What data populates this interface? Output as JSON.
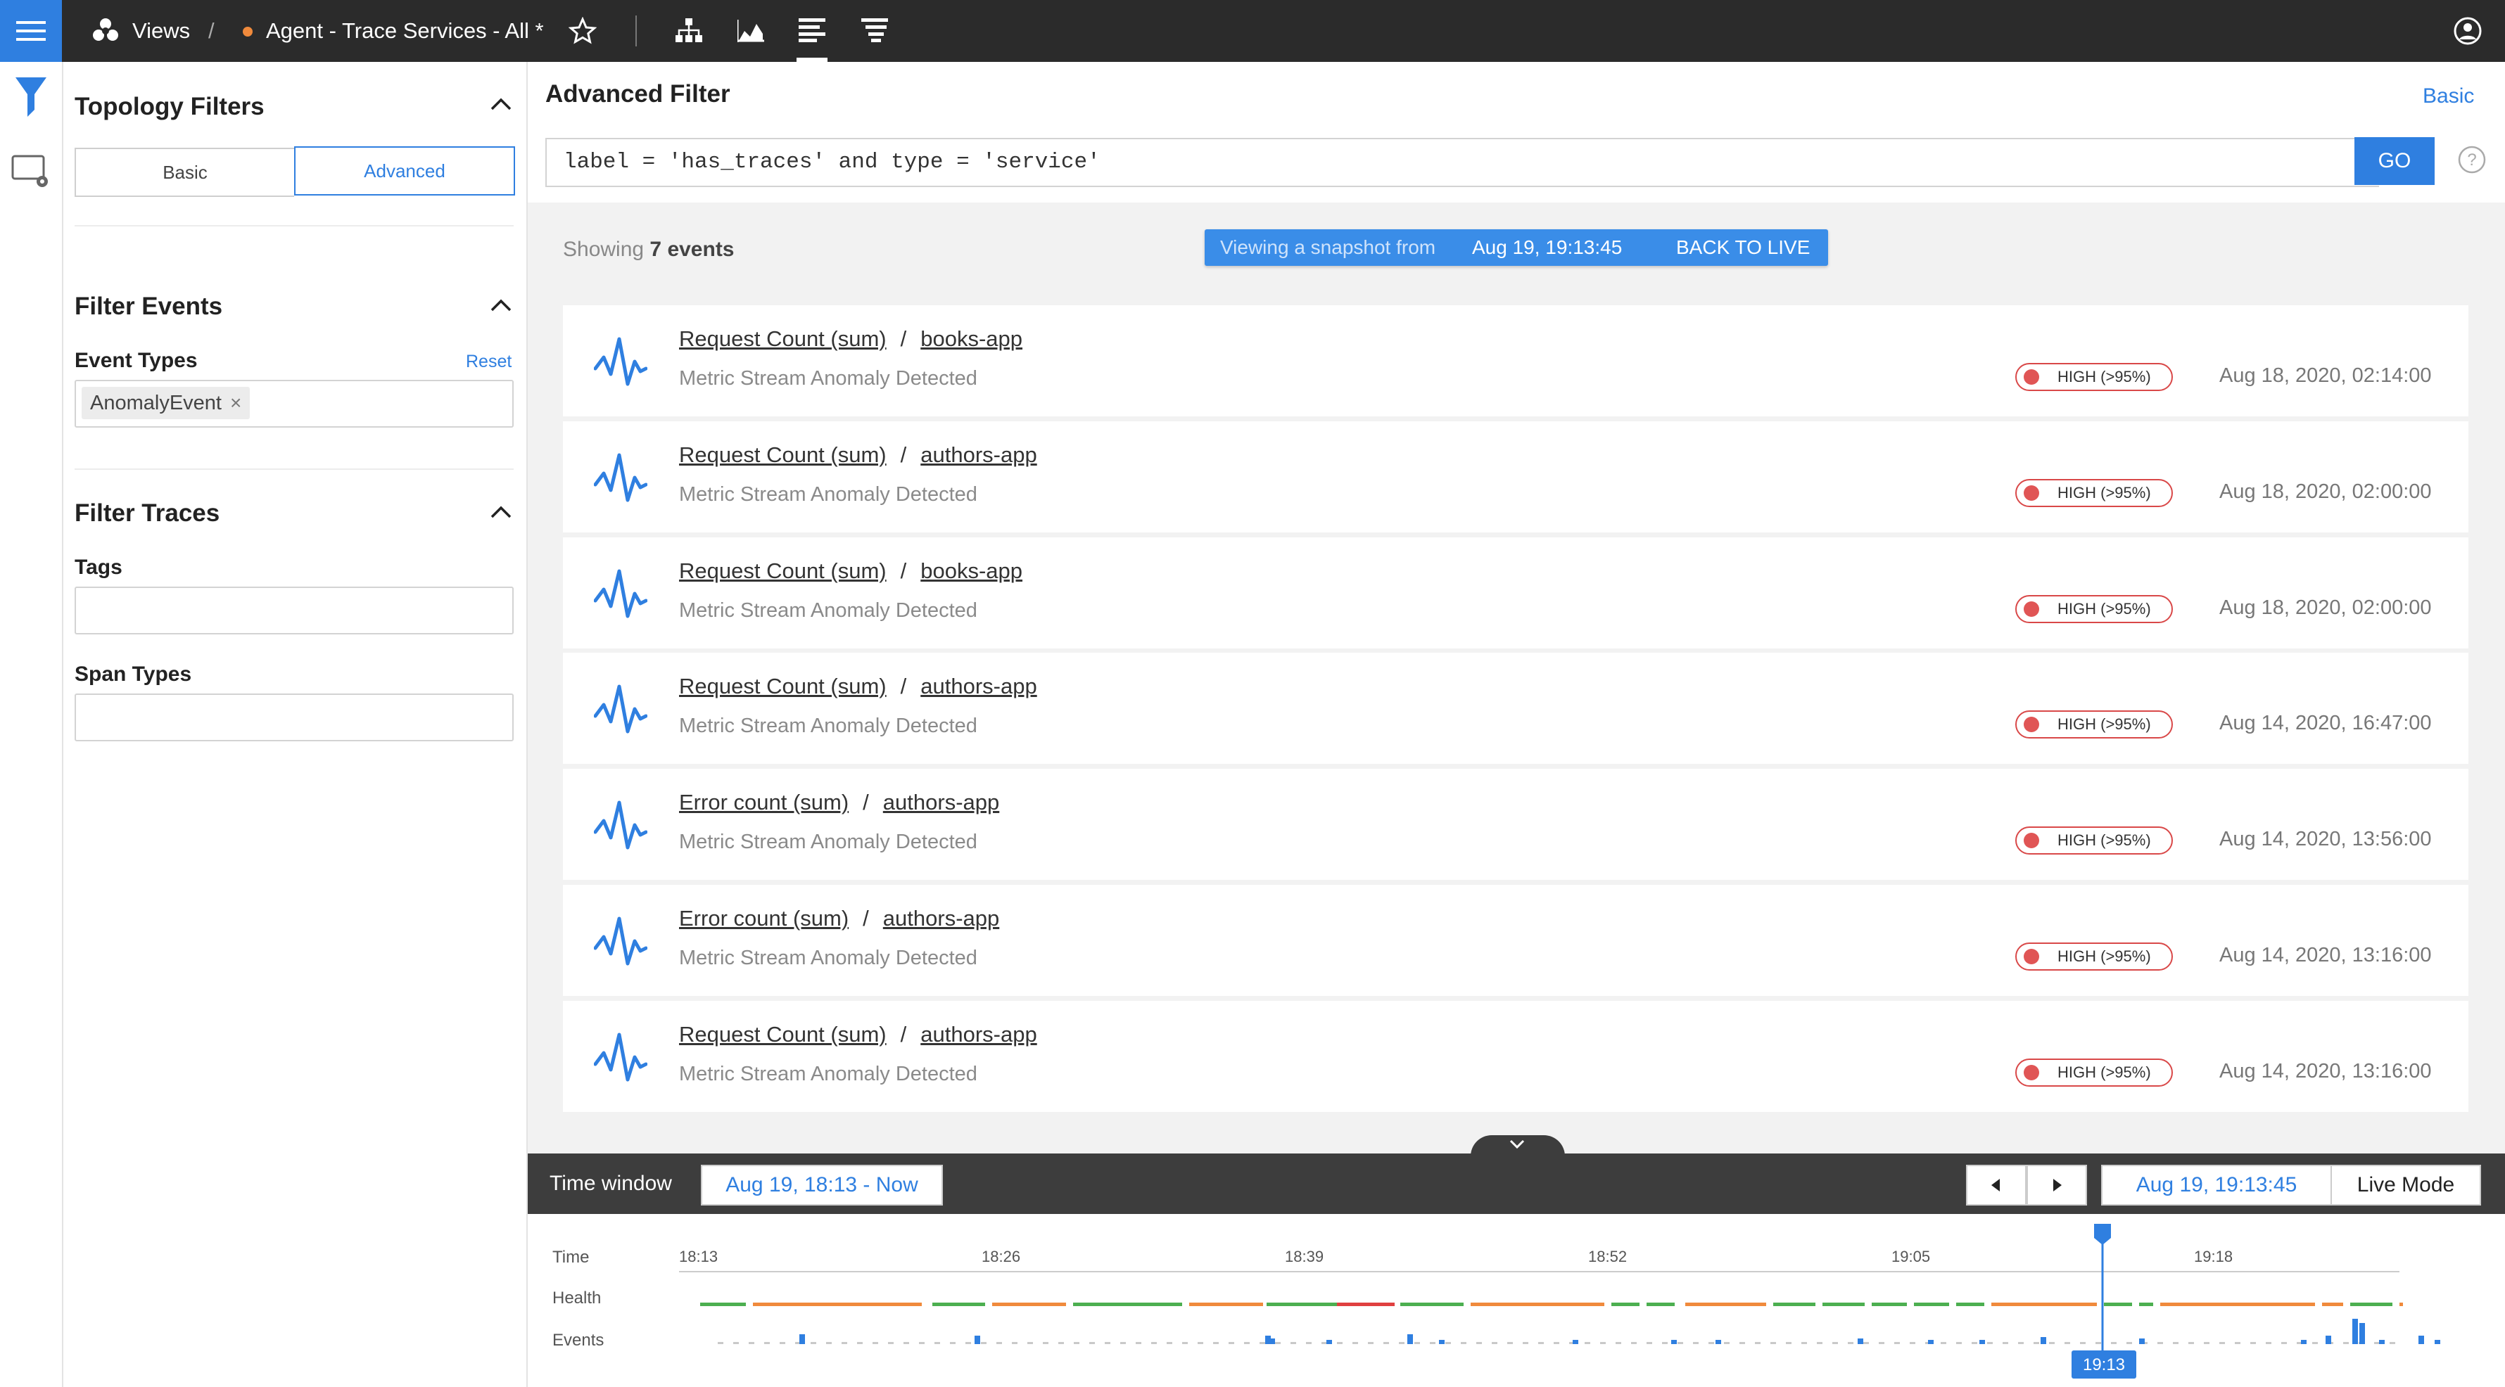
{
  "topbar": {
    "views_label": "Views",
    "separator": "/",
    "view_name": "Agent - Trace Services - All *",
    "icons": [
      "menu-icon",
      "views-icon",
      "star-icon",
      "topology-icon",
      "chart-icon",
      "events-list-icon",
      "traces-icon",
      "user-icon"
    ],
    "accent": "#2f7fe0"
  },
  "sidebar": {
    "title": "Topology Filters",
    "toggle": {
      "basic": "Basic",
      "advanced": "Advanced"
    },
    "filter_events": {
      "title": "Filter Events",
      "event_types_label": "Event Types",
      "reset_label": "Reset",
      "chip": "AnomalyEvent",
      "chip_remove": "×"
    },
    "filter_traces": {
      "title": "Filter Traces",
      "tags_label": "Tags",
      "span_types_label": "Span Types"
    }
  },
  "main": {
    "title": "Advanced Filter",
    "basic_link": "Basic",
    "query": "label = 'has_traces' and type = 'service'",
    "go_label": "GO",
    "showing_prefix": "Showing",
    "showing_count": "7 events",
    "snapshot": {
      "prefix": "Viewing a snapshot from",
      "time": "Aug 19, 19:13:45",
      "back_label": "BACK TO LIVE"
    },
    "events": [
      {
        "metric": "Request Count (sum)",
        "sep": "/",
        "service": "books-app",
        "subtitle": "Metric Stream Anomaly Detected",
        "severity": "HIGH (>95%)",
        "time": "Aug 18, 2020, 02:14:00"
      },
      {
        "metric": "Request Count (sum)",
        "sep": "/",
        "service": "authors-app",
        "subtitle": "Metric Stream Anomaly Detected",
        "severity": "HIGH (>95%)",
        "time": "Aug 18, 2020, 02:00:00"
      },
      {
        "metric": "Request Count (sum)",
        "sep": "/",
        "service": "books-app",
        "subtitle": "Metric Stream Anomaly Detected",
        "severity": "HIGH (>95%)",
        "time": "Aug 18, 2020, 02:00:00"
      },
      {
        "metric": "Request Count (sum)",
        "sep": "/",
        "service": "authors-app",
        "subtitle": "Metric Stream Anomaly Detected",
        "severity": "HIGH (>95%)",
        "time": "Aug 14, 2020, 16:47:00"
      },
      {
        "metric": "Error count (sum)",
        "sep": "/",
        "service": "authors-app",
        "subtitle": "Metric Stream Anomaly Detected",
        "severity": "HIGH (>95%)",
        "time": "Aug 14, 2020, 13:56:00"
      },
      {
        "metric": "Error count (sum)",
        "sep": "/",
        "service": "authors-app",
        "subtitle": "Metric Stream Anomaly Detected",
        "severity": "HIGH (>95%)",
        "time": "Aug 14, 2020, 13:16:00"
      },
      {
        "metric": "Request Count (sum)",
        "sep": "/",
        "service": "authors-app",
        "subtitle": "Metric Stream Anomaly Detected",
        "severity": "HIGH (>95%)",
        "time": "Aug 14, 2020, 13:16:00"
      }
    ]
  },
  "timewindow": {
    "label": "Time window",
    "range": "Aug 19, 18:13 - Now",
    "current": "Aug 19, 19:13:45",
    "live_mode": "Live Mode"
  },
  "timeline": {
    "row_labels": {
      "time": "Time",
      "health": "Health",
      "events": "Events"
    },
    "ticks": [
      "18:13",
      "18:26",
      "18:39",
      "18:52",
      "19:05",
      "19:18"
    ],
    "marker": "19:13",
    "health_colors": {
      "ok": "#4caf50",
      "warn": "#f08a3c",
      "crit": "#e04040"
    }
  }
}
